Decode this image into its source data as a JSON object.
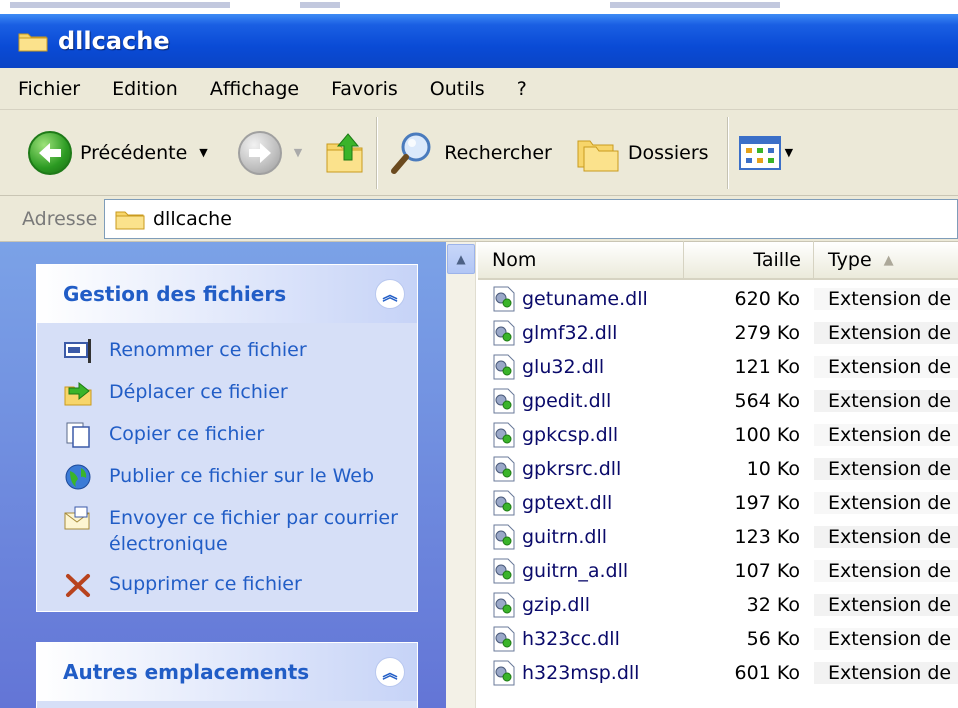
{
  "window": {
    "title": "dllcache"
  },
  "menu": {
    "items": [
      "Fichier",
      "Edition",
      "Affichage",
      "Favoris",
      "Outils",
      "?"
    ]
  },
  "toolbar": {
    "back_label": "Précédente",
    "search_label": "Rechercher",
    "folders_label": "Dossiers"
  },
  "address": {
    "label": "Adresse",
    "value": "dllcache"
  },
  "tasks": {
    "file_section_title": "Gestion des fichiers",
    "file_tasks": [
      {
        "label": "Renommer ce fichier",
        "icon": "rename-icon"
      },
      {
        "label": "Déplacer ce fichier",
        "icon": "move-icon"
      },
      {
        "label": "Copier ce fichier",
        "icon": "copy-icon"
      },
      {
        "label": "Publier ce fichier sur le Web",
        "icon": "globe-icon"
      },
      {
        "label": "Envoyer ce fichier par courrier électronique",
        "icon": "email-icon"
      },
      {
        "label": "Supprimer ce fichier",
        "icon": "delete-icon"
      }
    ],
    "other_section_title": "Autres emplacements"
  },
  "filelist": {
    "columns": {
      "name": "Nom",
      "size": "Taille",
      "type": "Type"
    },
    "rows": [
      {
        "name": "getuname.dll",
        "size": "620 Ko",
        "type": "Extension de"
      },
      {
        "name": "glmf32.dll",
        "size": "279 Ko",
        "type": "Extension de"
      },
      {
        "name": "glu32.dll",
        "size": "121 Ko",
        "type": "Extension de"
      },
      {
        "name": "gpedit.dll",
        "size": "564 Ko",
        "type": "Extension de"
      },
      {
        "name": "gpkcsp.dll",
        "size": "100 Ko",
        "type": "Extension de"
      },
      {
        "name": "gpkrsrc.dll",
        "size": "10 Ko",
        "type": "Extension de"
      },
      {
        "name": "gptext.dll",
        "size": "197 Ko",
        "type": "Extension de"
      },
      {
        "name": "guitrn.dll",
        "size": "123 Ko",
        "type": "Extension de"
      },
      {
        "name": "guitrn_a.dll",
        "size": "107 Ko",
        "type": "Extension de"
      },
      {
        "name": "gzip.dll",
        "size": "32 Ko",
        "type": "Extension de"
      },
      {
        "name": "h323cc.dll",
        "size": "56 Ko",
        "type": "Extension de"
      },
      {
        "name": "h323msp.dll",
        "size": "601 Ko",
        "type": "Extension de"
      }
    ]
  },
  "colors": {
    "title_bar": "#0a4bd6",
    "task_link": "#215dc6",
    "chrome": "#ece9d8"
  }
}
